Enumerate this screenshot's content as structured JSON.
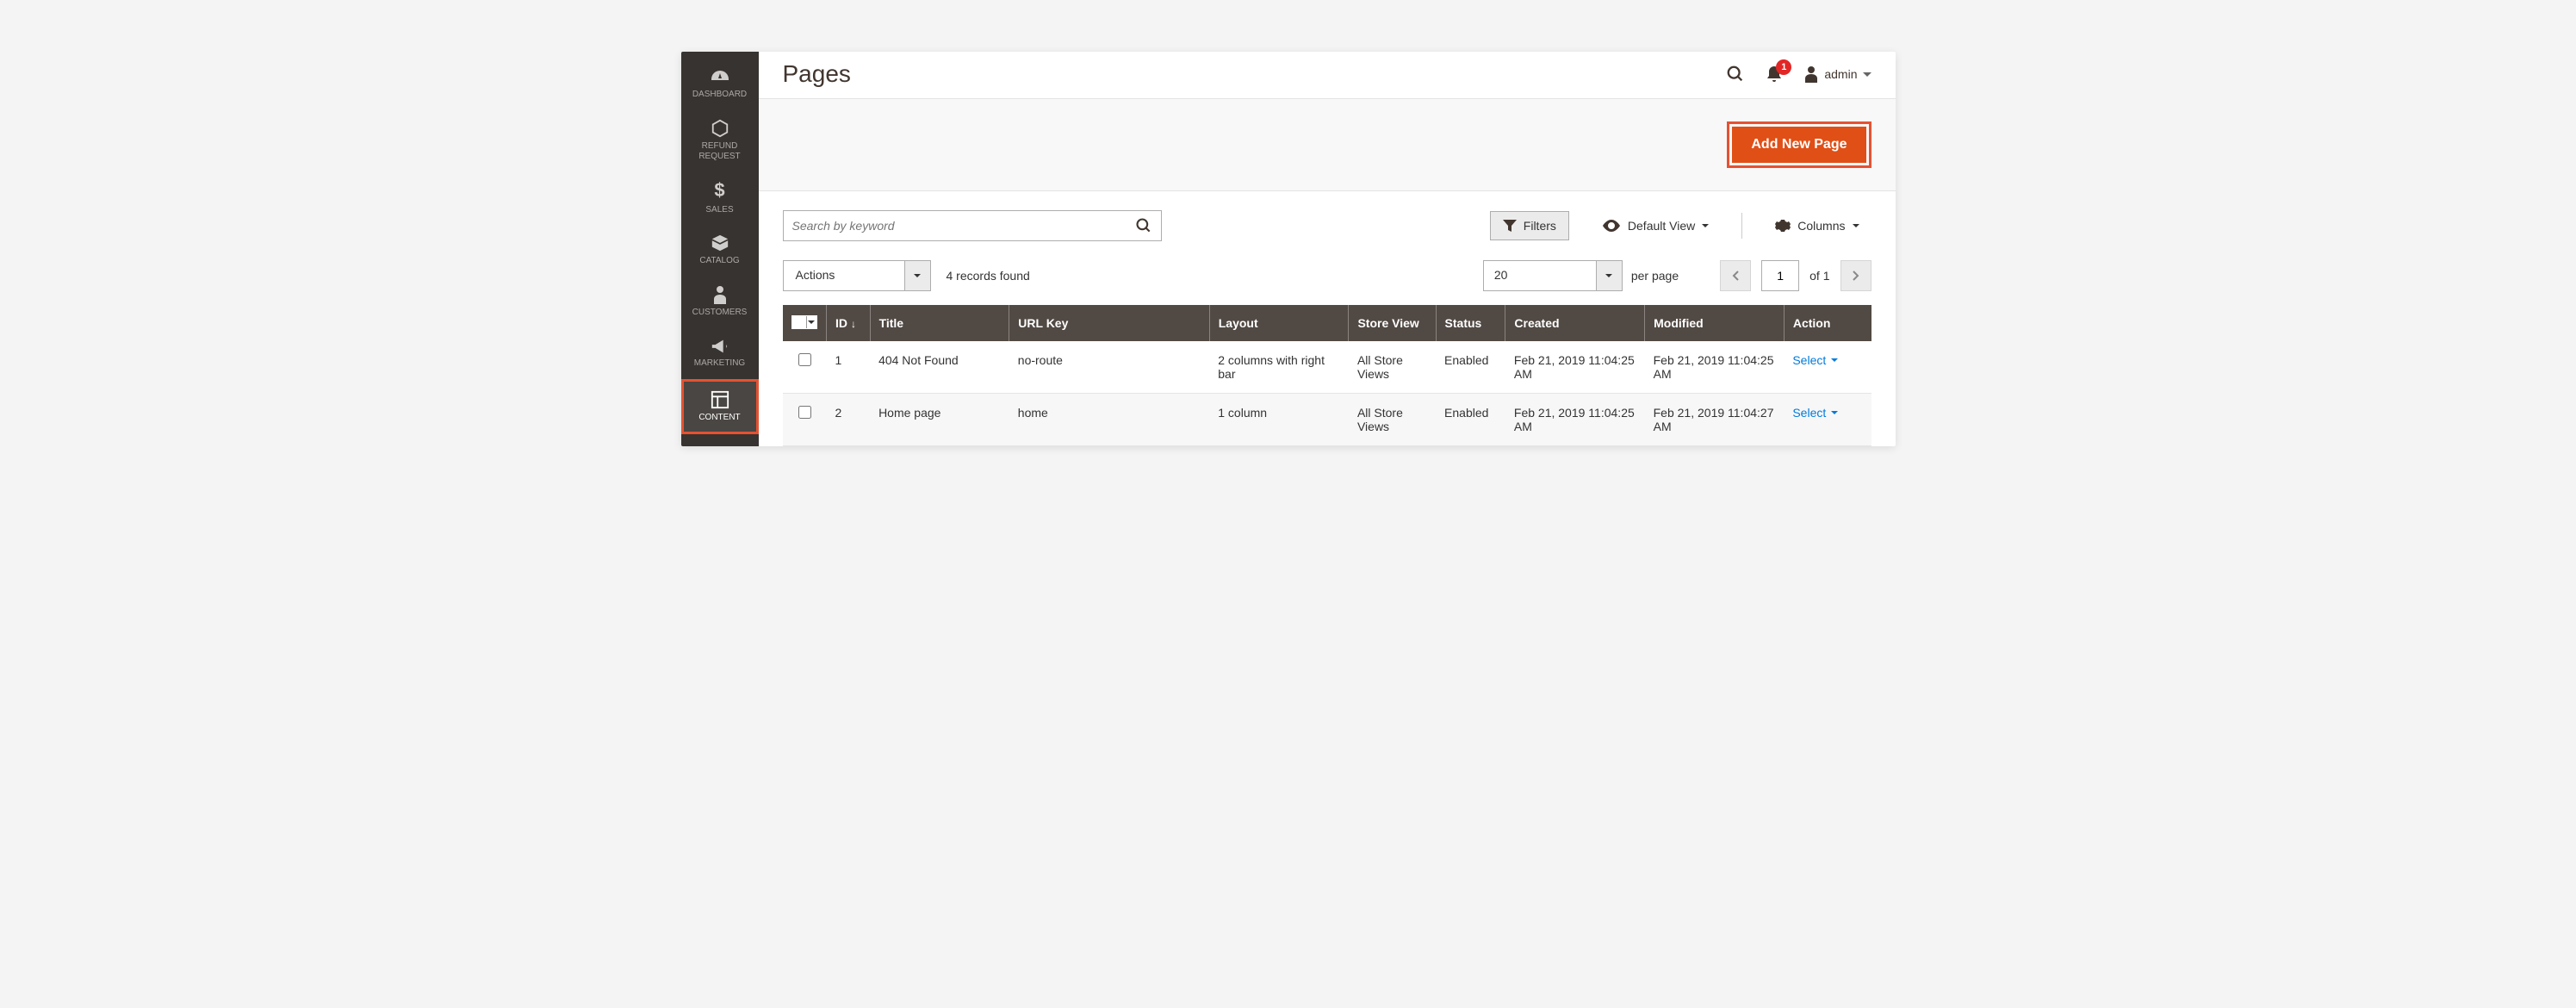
{
  "sidebar": {
    "items": [
      {
        "label": "DASHBOARD"
      },
      {
        "label": "REFUND REQUEST"
      },
      {
        "label": "SALES"
      },
      {
        "label": "CATALOG"
      },
      {
        "label": "CUSTOMERS"
      },
      {
        "label": "MARKETING"
      },
      {
        "label": "CONTENT"
      }
    ]
  },
  "header": {
    "title": "Pages",
    "notification_count": "1",
    "user": "admin"
  },
  "actionbar": {
    "add_label": "Add New Page"
  },
  "toolbar": {
    "search_placeholder": "Search by keyword",
    "filters_label": "Filters",
    "default_view_label": "Default View",
    "columns_label": "Columns"
  },
  "controls": {
    "actions_label": "Actions",
    "records_found": "4 records found",
    "per_page_value": "20",
    "per_page_label": "per page",
    "page_value": "1",
    "page_of": "of 1"
  },
  "table": {
    "columns": [
      "ID",
      "Title",
      "URL Key",
      "Layout",
      "Store View",
      "Status",
      "Created",
      "Modified",
      "Action"
    ],
    "rows": [
      {
        "id": "1",
        "title": "404 Not Found",
        "url_key": "no-route",
        "layout": "2 columns with right bar",
        "store_view": "All Store Views",
        "status": "Enabled",
        "created": "Feb 21, 2019 11:04:25 AM",
        "modified": "Feb 21, 2019 11:04:25 AM",
        "action": "Select"
      },
      {
        "id": "2",
        "title": "Home page",
        "url_key": "home",
        "layout": "1 column",
        "store_view": "All Store Views",
        "status": "Enabled",
        "created": "Feb 21, 2019 11:04:25 AM",
        "modified": "Feb 21, 2019 11:04:27 AM",
        "action": "Select"
      }
    ]
  }
}
